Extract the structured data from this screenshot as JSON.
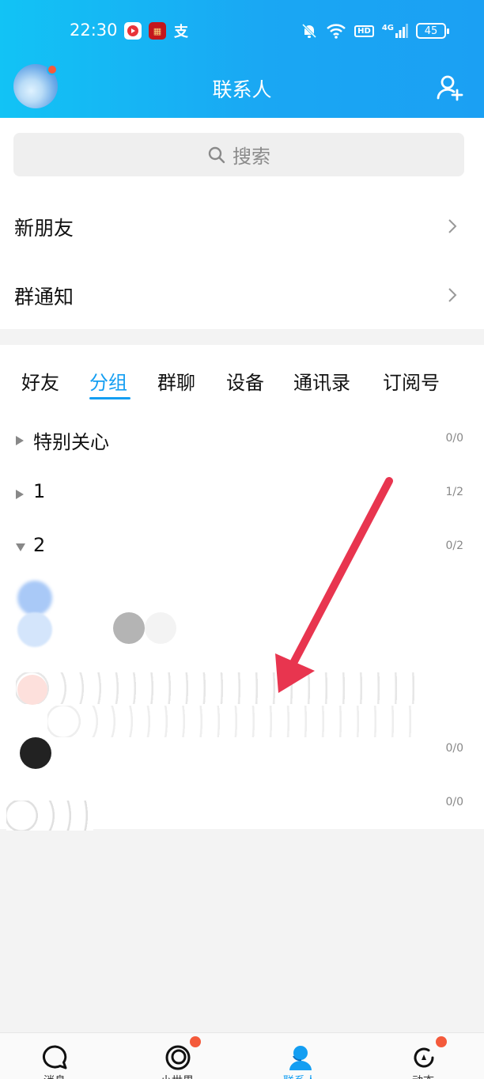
{
  "status_bar": {
    "time": "22:30",
    "network": "4G",
    "hd": "HD",
    "battery": "45",
    "app_icons": [
      "media-icon",
      "news-icon",
      "alipay-icon"
    ]
  },
  "header": {
    "title": "联系人",
    "avatar_badge": true
  },
  "search": {
    "placeholder": "搜索"
  },
  "rows": [
    {
      "label": "新朋友"
    },
    {
      "label": "群通知"
    }
  ],
  "tabs": [
    {
      "label": "好友",
      "active": false
    },
    {
      "label": "分组",
      "active": true
    },
    {
      "label": "群聊",
      "active": false
    },
    {
      "label": "设备",
      "active": false
    },
    {
      "label": "通讯录",
      "active": false
    },
    {
      "label": "订阅号",
      "active": false
    }
  ],
  "groups": [
    {
      "name": "特别关心",
      "count": "0/0",
      "expanded": false
    },
    {
      "name": "1",
      "count": "1/2",
      "expanded": false
    },
    {
      "name": "2",
      "count": "0/2",
      "expanded": true
    }
  ],
  "hidden_rows": [
    {
      "count": "0/0"
    },
    {
      "count": "0/0"
    }
  ],
  "colors": {
    "accent": "#139ef2",
    "header_start": "#12c3f5",
    "header_end": "#1ba0f3",
    "badge": "#f45a3b",
    "arrow": "#e8354f"
  },
  "bottom_nav": [
    {
      "label": "消息",
      "icon": "chat-bubble-icon",
      "active": false,
      "badge": false
    },
    {
      "label": "小世界",
      "icon": "world-icon",
      "active": false,
      "badge": true
    },
    {
      "label": "联系人",
      "icon": "contacts-icon",
      "active": true,
      "badge": false
    },
    {
      "label": "动态",
      "icon": "activity-icon",
      "active": false,
      "badge": true
    }
  ]
}
